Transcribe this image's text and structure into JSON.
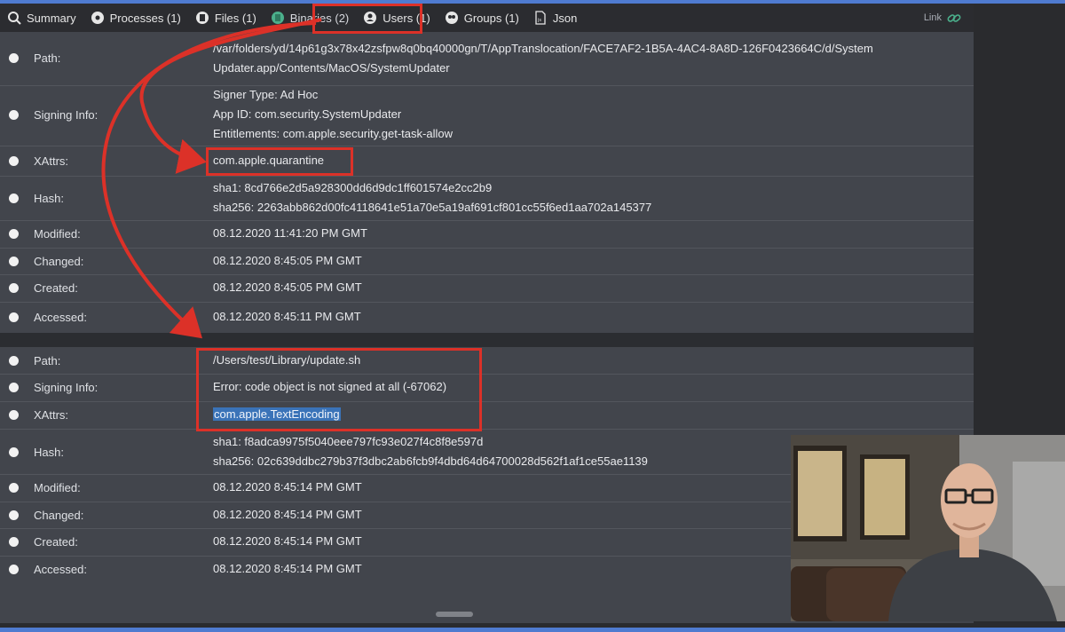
{
  "tabs": [
    {
      "label": "Summary",
      "icon": "magnifier-icon"
    },
    {
      "label": "Processes (1)",
      "icon": "gears-icon"
    },
    {
      "label": "Files (1)",
      "icon": "file-icon"
    },
    {
      "label": "Binaries (2)",
      "icon": "binary-icon",
      "active": true
    },
    {
      "label": "Users (1)",
      "icon": "user-icon"
    },
    {
      "label": "Groups (1)",
      "icon": "group-icon"
    },
    {
      "label": "Json",
      "icon": "json-icon"
    }
  ],
  "link_label": "Link",
  "binary1": {
    "path_label": "Path:",
    "path_line1": "/var/folders/yd/14p61g3x78x42zsfpw8q0bq40000gn/T/AppTranslocation/FACE7AF2-1B5A-4AC4-8A8D-126F0423664C/d/System",
    "path_line2": "Updater.app/Contents/MacOS/SystemUpdater",
    "signing_label": "Signing Info:",
    "signer_type": "Signer Type: Ad Hoc",
    "app_id": "App ID: com.security.SystemUpdater",
    "entitlements": "Entitlements: com.apple.security.get-task-allow",
    "xattrs_label": "XAttrs:",
    "xattrs": "com.apple.quarantine",
    "hash_label": "Hash:",
    "sha1": "sha1: 8cd766e2d5a928300dd6d9dc1ff601574e2cc2b9",
    "sha256": "sha256: 2263abb862d00fc4118641e51a70e5a19af691cf801cc55f6ed1aa702a145377",
    "modified_label": "Modified:",
    "modified": "08.12.2020 11:41:20 PM GMT",
    "changed_label": "Changed:",
    "changed": "08.12.2020 8:45:05 PM GMT",
    "created_label": "Created:",
    "created": "08.12.2020 8:45:05 PM GMT",
    "accessed_label": "Accessed:",
    "accessed": "08.12.2020 8:45:11 PM GMT"
  },
  "binary2": {
    "path_label": "Path:",
    "path": "/Users/test/Library/update.sh",
    "signing_label": "Signing Info:",
    "signing_error": "Error: code object is not signed at all (-67062)",
    "xattrs_label": "XAttrs:",
    "xattrs": "com.apple.TextEncoding",
    "hash_label": "Hash:",
    "sha1": "sha1: f8adca9975f5040eee797fc93e027f4c8f8e597d",
    "sha256": "sha256: 02c639ddbc279b37f3dbc2ab6fcb9f4dbd64d64700028d562f1af1ce55ae1139",
    "modified_label": "Modified:",
    "modified": "08.12.2020 8:45:14 PM GMT",
    "changed_label": "Changed:",
    "changed": "08.12.2020 8:45:14 PM GMT",
    "created_label": "Created:",
    "created": "08.12.2020 8:45:14 PM GMT",
    "accessed_label": "Accessed:",
    "accessed": "08.12.2020 8:45:14 PM GMT"
  },
  "colors": {
    "accent": "#4f7bd0",
    "annotation": "#dc3128",
    "error_text": "#58b08f",
    "panel": "#42454c"
  }
}
